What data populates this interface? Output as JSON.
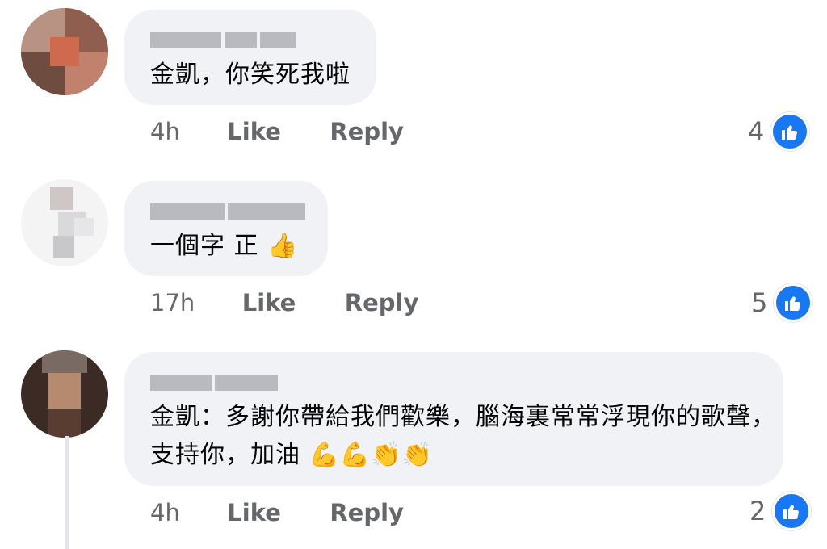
{
  "comments": [
    {
      "text": "金凱，你笑死我啦",
      "time": "4h",
      "like_label": "Like",
      "reply_label": "Reply",
      "reaction_count": "4"
    },
    {
      "text": "一個字 正",
      "emoji": "👍",
      "time": "17h",
      "like_label": "Like",
      "reply_label": "Reply",
      "reaction_count": "5"
    },
    {
      "line1": "金凱：多謝你帶給我們歡樂，腦海裏常常浮現你的歌聲，",
      "line2": "支持你，加油",
      "emoji": "💪💪👏👏",
      "time": "4h",
      "like_label": "Like",
      "reply_label": "Reply",
      "reaction_count": "2"
    }
  ],
  "colors": {
    "bubble": "#f0f2f5",
    "meta_text": "#65676b",
    "like_blue": "#1877f2"
  },
  "icons": {
    "reaction": "thumbs-up-icon",
    "avatar": "blurred-avatar"
  }
}
